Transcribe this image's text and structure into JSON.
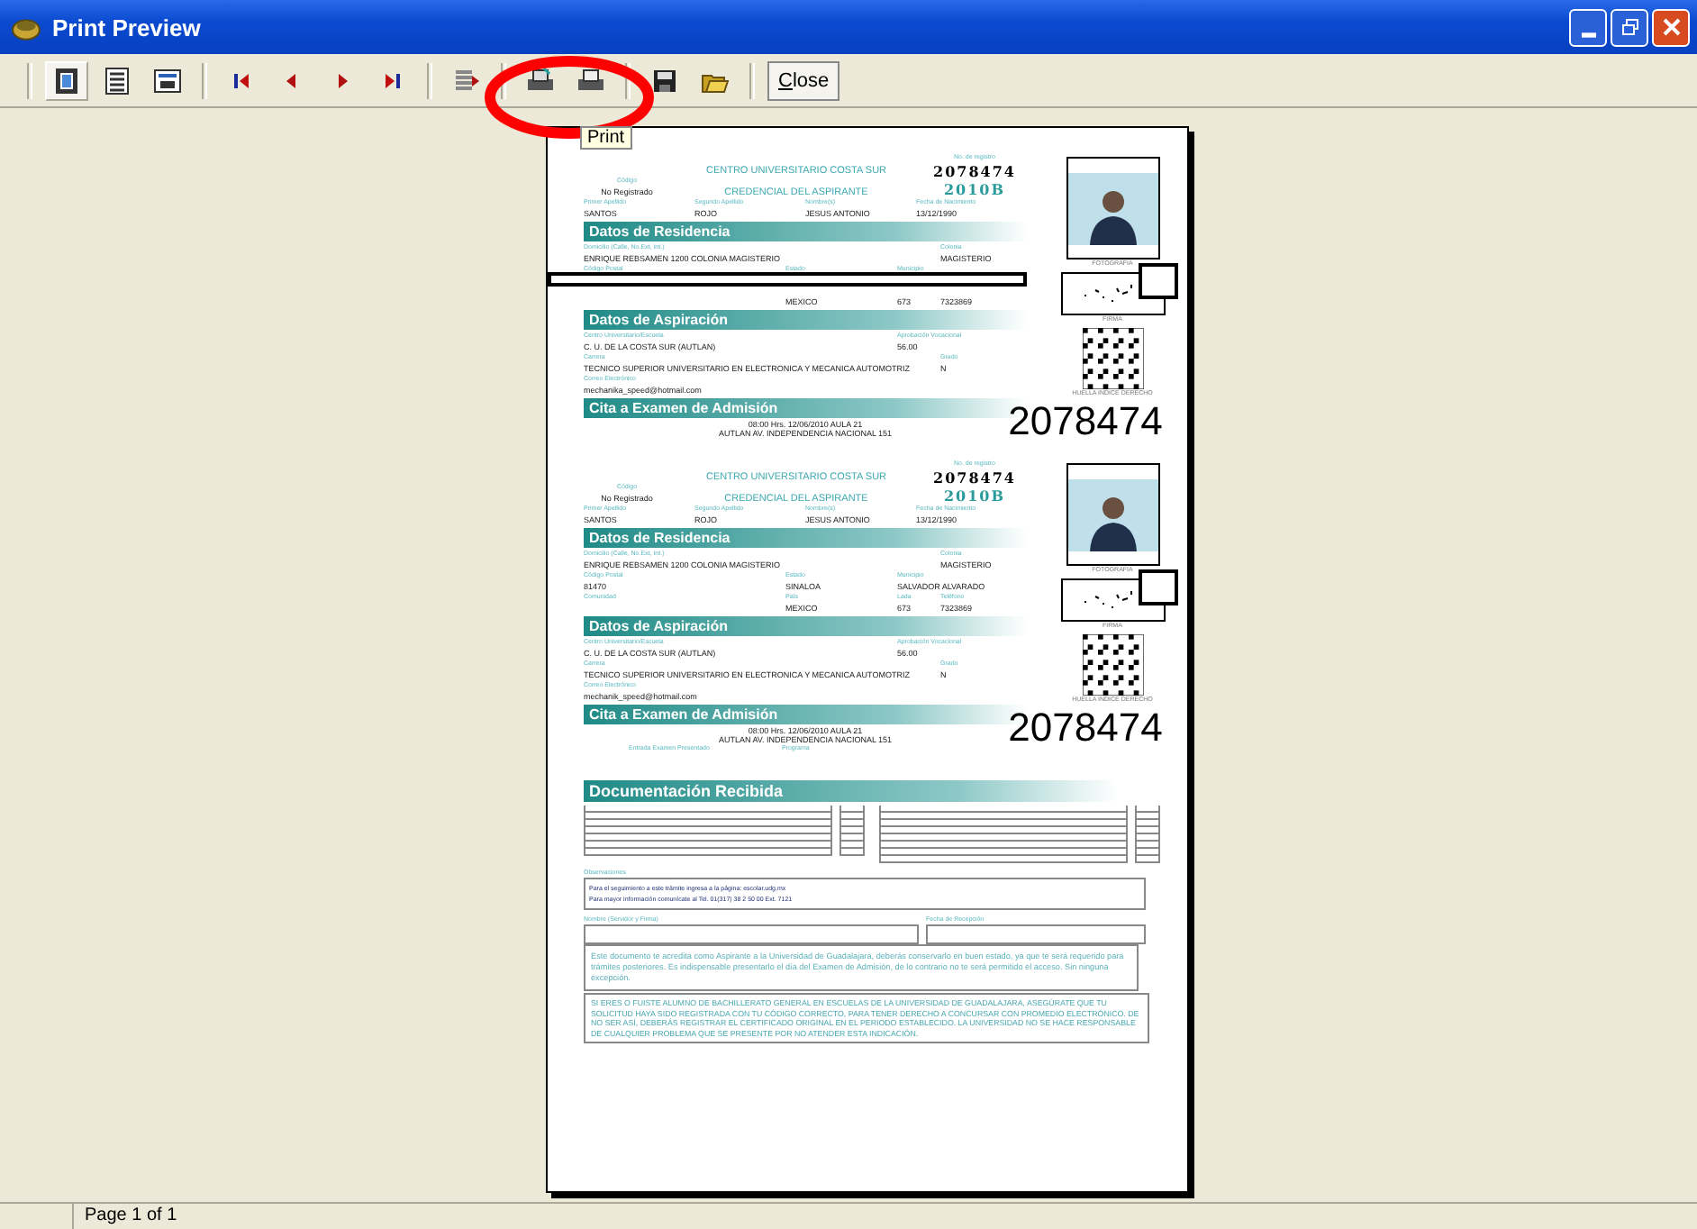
{
  "window": {
    "title": "Print Preview"
  },
  "toolbar": {
    "buttons": [
      {
        "kind": "one-page",
        "selected": true
      },
      {
        "kind": "lines",
        "selected": false
      },
      {
        "kind": "fit",
        "selected": false
      },
      {
        "kind": "first",
        "selected": false
      },
      {
        "kind": "prev",
        "selected": false
      },
      {
        "kind": "next",
        "selected": false
      },
      {
        "kind": "last",
        "selected": false
      },
      {
        "kind": "goto",
        "selected": false
      },
      {
        "kind": "print-setup",
        "selected": false
      },
      {
        "kind": "print",
        "selected": false
      },
      {
        "kind": "save",
        "selected": false
      },
      {
        "kind": "open",
        "selected": false
      }
    ],
    "close_label": "Close",
    "tooltip": "Print"
  },
  "credentials": [
    {
      "reg_label": "No. de registro",
      "reg_number": "2078474",
      "center": "CENTRO UNIVERSITARIO COSTA SUR",
      "code_label": "Código",
      "code": "No Registrado",
      "title": "CREDENCIAL DEL ASPIRANTE",
      "period": "2010B",
      "name_row": [
        {
          "label": "Primer Apellido",
          "value": "SANTOS"
        },
        {
          "label": "Segundo Apellido",
          "value": "ROJO"
        },
        {
          "label": "Nombre(s)",
          "value": "JESUS ANTONIO"
        },
        {
          "label": "Fecha de Nacimiento",
          "value": "13/12/1990"
        }
      ],
      "sections": [
        {
          "title": "Datos de Residencia",
          "rows": [
            {
              "redacted": false,
              "cells": [
                {
                  "label": "Domicilio (Calle, No.Ext, Int.)",
                  "value": "ENRIQUE REBSAMEN 1200 COLONIA MAGISTERIO"
                },
                {},
                {},
                {
                  "label": "Colonia",
                  "value": "MAGISTERIO"
                }
              ]
            },
            {
              "redacted": true,
              "cells": [
                {
                  "label": "Código Postal"
                },
                {
                  "label": "Estado"
                },
                {
                  "label": "Municipio"
                }
              ]
            },
            {
              "redacted": false,
              "cells": [
                {},
                {
                  "value": "MEXICO"
                },
                {
                  "value": "673"
                },
                {
                  "value": "7323869"
                }
              ]
            }
          ]
        },
        {
          "title": "Datos de Aspiración",
          "rows": [
            {
              "redacted": false,
              "cells": [
                {
                  "label": "Centro Universitario/Escuela",
                  "value": "C. U. DE LA COSTA SUR (AUTLAN)"
                },
                {},
                {
                  "label": "Aprobación Vocacional",
                  "value": "56.00"
                }
              ]
            },
            {
              "redacted": false,
              "cells": [
                {
                  "label": "Carrera",
                  "value": "TECNICO SUPERIOR UNIVERSITARIO EN ELECTRONICA Y MECANICA AUTOMOTRIZ"
                },
                {},
                {},
                {
                  "label": "Grado",
                  "value": "N"
                }
              ]
            },
            {
              "redacted": false,
              "cells": [
                {
                  "label": "Correo Electrónico",
                  "value": "mechanika_speed@hotmail.com"
                }
              ]
            }
          ]
        },
        {
          "title": "Cita a Examen de Admisión",
          "lines": [
            "08:00 Hrs. 12/06/2010 AULA 21",
            "AUTLAN AV. INDEPENDENCIA NACIONAL 151"
          ]
        }
      ],
      "photo_caption": "FOTOGRAFIA",
      "signature_caption": "FIRMA",
      "fingerprint_caption": "HUELLA INDICE DERECHO",
      "big_number": "2078474"
    },
    {
      "reg_label": "No. de registro",
      "reg_number": "2078474",
      "center": "CENTRO UNIVERSITARIO COSTA SUR",
      "code_label": "Código",
      "code": "No Registrado",
      "title": "CREDENCIAL DEL ASPIRANTE",
      "period": "2010B",
      "name_row": [
        {
          "label": "Primer Apellido",
          "value": "SANTOS"
        },
        {
          "label": "Segundo Apellido",
          "value": "ROJO"
        },
        {
          "label": "Nombre(s)",
          "value": "JESUS ANTONIO"
        },
        {
          "label": "Fecha de Nacimiento",
          "value": "13/12/1990"
        }
      ],
      "sections": [
        {
          "title": "Datos de Residencia",
          "rows": [
            {
              "redacted": false,
              "cells": [
                {
                  "label": "Domicilio (Calle, No.Ext, Int.)",
                  "value": "ENRIQUE REBSAMEN 1200 COLONIA MAGISTERIO"
                },
                {},
                {},
                {
                  "label": "Colonia",
                  "value": "MAGISTERIO"
                }
              ]
            },
            {
              "redacted": false,
              "cells": [
                {
                  "label": "Código Postal",
                  "value": "81470"
                },
                {
                  "label": "Estado",
                  "value": "SINALOA"
                },
                {
                  "label": "Municipio",
                  "value": "SALVADOR ALVARADO"
                }
              ]
            },
            {
              "redacted": false,
              "cells": [
                {
                  "label": "Comunidad"
                },
                {
                  "label": "País",
                  "value": "MEXICO"
                },
                {
                  "label": "Lada",
                  "value": "673"
                },
                {
                  "label": "Teléfono",
                  "value": "7323869"
                }
              ]
            }
          ]
        },
        {
          "title": "Datos de Aspiración",
          "rows": [
            {
              "redacted": false,
              "cells": [
                {
                  "label": "Centro Universitario/Escuela",
                  "value": "C. U. DE LA COSTA SUR (AUTLAN)"
                },
                {},
                {
                  "label": "Aprobación Vocacional",
                  "value": "56.00"
                }
              ]
            },
            {
              "redacted": false,
              "cells": [
                {
                  "label": "Carrera",
                  "value": "TECNICO SUPERIOR UNIVERSITARIO EN ELECTRONICA Y MECANICA AUTOMOTRIZ"
                },
                {},
                {},
                {
                  "label": "Grado",
                  "value": "N"
                }
              ]
            },
            {
              "redacted": false,
              "cells": [
                {
                  "label": "Correo Electrónico",
                  "value": "mechanik_speed@hotmail.com"
                }
              ]
            }
          ]
        },
        {
          "title": "Cita a Examen de Admisión",
          "lines": [
            "08:00 Hrs. 12/06/2010 AULA 21",
            "AUTLAN AV. INDEPENDENCIA NACIONAL 151"
          ],
          "footer_labels": [
            "Entrada Examen Presentado",
            "Programa"
          ]
        }
      ],
      "photo_caption": "FOTOGRAFIA",
      "signature_caption": "FIRMA",
      "fingerprint_caption": "HUELLA INDICE DERECHO",
      "big_number": "2078474"
    }
  ],
  "documents": {
    "title": "Documentación Recibida",
    "columns": [
      [
        {
          "checked": false
        },
        {
          "checked": false
        },
        {
          "checked": false
        },
        {
          "checked": false
        },
        {
          "checked": false
        },
        {
          "checked": false
        },
        {
          "checked": false
        }
      ],
      [
        {
          "checked": false
        },
        {
          "checked": false
        },
        {
          "checked": false
        },
        {
          "checked": false
        },
        {
          "checked": false
        },
        {
          "checked": false
        },
        {
          "checked": false
        },
        {
          "checked": false
        }
      ]
    ],
    "observations_label": "Observaciones",
    "observations": [
      "Para el seguimiento a este trámite ingresa a la página: escolar.udg.mx",
      "Para mayor información comunícate al Tel. 01(317) 38 2 50 00 Ext. 7121"
    ],
    "receiver_label": "Nombre (Servidor y Firma)",
    "date_label": "Fecha de Recepción",
    "notice": "Este documento te acredita como Aspirante a la Universidad de Guadalajara, deberás conservarlo en buen estado, ya que te será requerido para trámites posteriores. Es indispensable presentarlo el día del Examen de Admisión, de lo contrario no te será permitido el acceso. Sin ninguna excepción.",
    "warning": "SI ERES O FUISTE ALUMNO DE BACHILLERATO GENERAL EN ESCUELAS DE LA UNIVERSIDAD DE GUADALAJARA, ASEGÚRATE QUE TU SOLICITUD HAYA SIDO REGISTRADA CON TU CÓDIGO CORRECTO, PARA TENER DERECHO A CONCURSAR CON PROMEDIO ELECTRÓNICO. DE NO SER ASÍ, DEBERÁS REGISTRAR EL CERTIFICADO ORIGINAL EN EL PERIODO ESTABLECIDO. LA UNIVERSIDAD NO SE HACE RESPONSABLE DE CUALQUIER PROBLEMA QUE SE PRESENTE POR NO ATENDER ESTA INDICACIÓN."
  },
  "status_bar": {
    "page": "Page 1 of 1"
  }
}
